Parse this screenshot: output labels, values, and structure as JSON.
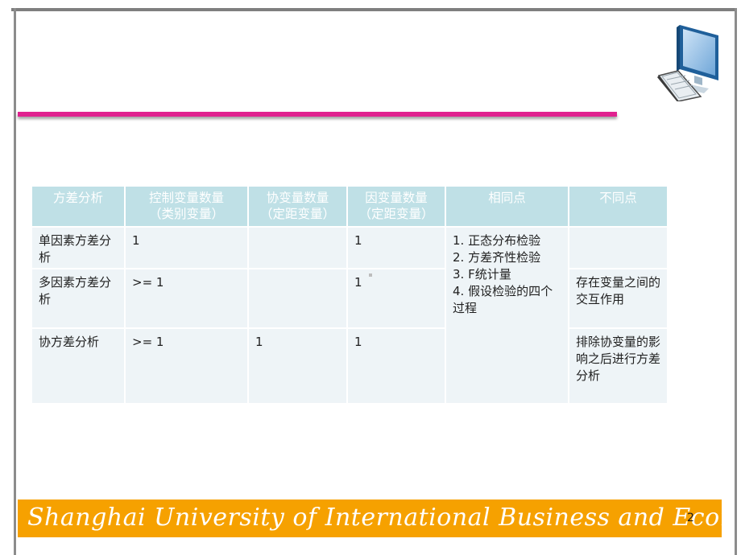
{
  "header": {
    "columns": [
      "方差分析",
      "控制变量数量",
      "协变量数量",
      "因变量数量",
      "相同点",
      "不同点"
    ],
    "subtitles": [
      "",
      "（类别变量）",
      "（定距变量）",
      "（定距变量）",
      "",
      ""
    ]
  },
  "rows": [
    {
      "name": "单因素方差分析",
      "control": "1",
      "covariate": "",
      "dependent": "1",
      "difference": ""
    },
    {
      "name": "多因素方差分析",
      "control": ">= 1",
      "covariate": "",
      "dependent": "1",
      "difference": "存在变量之间的交互作用"
    },
    {
      "name": "协方差分析",
      "control": ">= 1",
      "covariate": "1",
      "dependent": "1",
      "difference": "排除协变量的影响之后进行方差分析"
    }
  ],
  "common": [
    "1. 正态分布检验",
    "2. 方差齐性检验",
    "3. F统计量",
    "4. 假设检验的四个过程"
  ],
  "footer": {
    "text": "Shanghai University of International Business and Economics"
  },
  "page_number": "2",
  "colors": {
    "header_bg": "#bfe0e6",
    "cell_bg": "#eef4f7",
    "accent_rule": "#e0228f",
    "footer_bg": "#f6a100"
  },
  "icons": {
    "decoration": "computer-icon"
  }
}
